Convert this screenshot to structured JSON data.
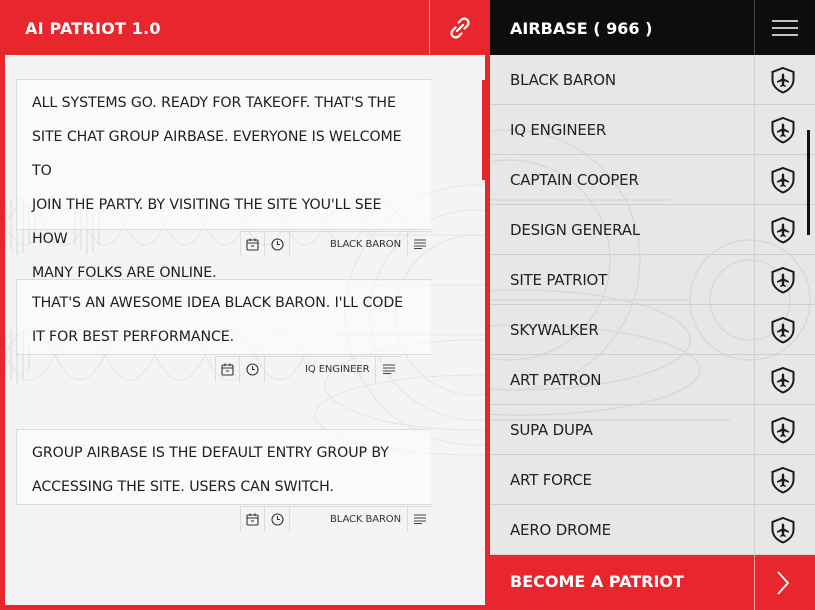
{
  "app": {
    "title": "AI PATRIOT 1.0"
  },
  "icons": {
    "header_link": "link-chain-icon",
    "calendar": "calendar-icon",
    "clock": "clock-icon",
    "message_menu": "lines-menu-icon",
    "roster_menu": "hamburger-menu-icon",
    "user_badge": "airplane-shield-icon",
    "become": "chevron-right-icon"
  },
  "colors": {
    "accent": "#e8262d",
    "dark": "#0d0d0d",
    "panel": "#f4f4f4",
    "roster_bg": "#e7e7e7"
  },
  "messages": [
    {
      "lines": [
        "ALL SYSTEMS GO. READY FOR TAKEOFF. THAT'S THE",
        "SITE CHAT GROUP AIRBASE. EVERYONE IS WELCOME TO",
        "JOIN THE PARTY. BY VISITING THE SITE YOU'LL SEE HOW",
        "MANY FOLKS ARE ONLINE."
      ],
      "author": "BLACK BARON"
    },
    {
      "lines": [
        "THAT'S AN AWESOME IDEA BLACK BARON. I'LL CODE",
        "IT FOR BEST PERFORMANCE."
      ],
      "author": "IQ ENGINEER"
    },
    {
      "lines": [
        "GROUP AIRBASE IS THE DEFAULT ENTRY GROUP BY",
        "ACCESSING THE SITE. USERS CAN SWITCH."
      ],
      "author": "BLACK BARON"
    }
  ],
  "roster": {
    "title": "AIRBASE ( 966 )",
    "users": [
      "BLACK BARON",
      "IQ ENGINEER",
      "CAPTAIN COOPER",
      "DESIGN GENERAL",
      "SITE PATRIOT",
      "SKYWALKER",
      "ART PATRON",
      "SUPA DUPA",
      "ART FORCE",
      "AERO DROME"
    ]
  },
  "become_button": {
    "label": "BECOME A PATRIOT"
  }
}
